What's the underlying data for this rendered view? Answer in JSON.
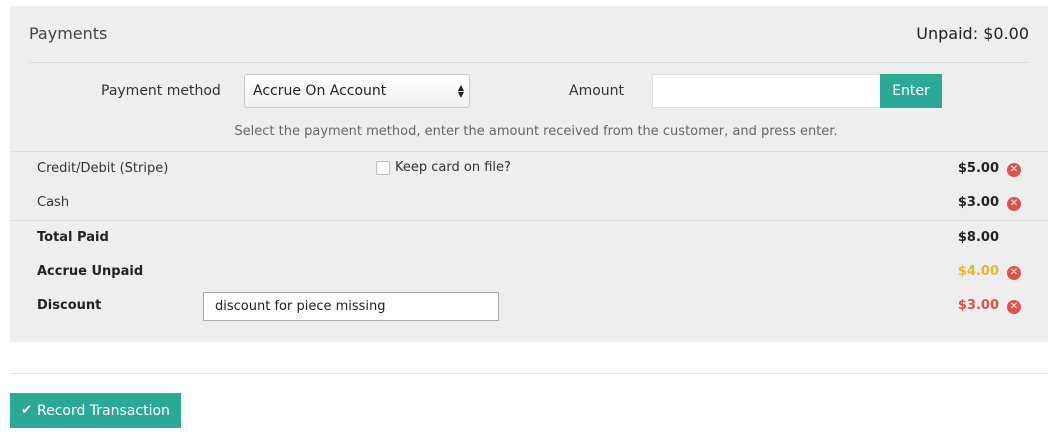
{
  "payments": {
    "title": "Payments",
    "unpaid": "Unpaid: $0.00"
  },
  "form": {
    "method_label": "Payment method",
    "method_value": "Accrue On Account",
    "amount_label": "Amount",
    "amount_value": "",
    "enter_label": "Enter",
    "help": "Select the payment method, enter the amount received from the customer, and press enter."
  },
  "rows": [
    {
      "label": "Credit/Debit (Stripe)",
      "amount": "$5.00",
      "checkbox_label": "Keep card on file?",
      "checked": false
    },
    {
      "label": "Cash",
      "amount": "$3.00"
    },
    {
      "label": "Total Paid",
      "amount": "$8.00"
    },
    {
      "label": "Accrue Unpaid",
      "amount": "$4.00"
    },
    {
      "label": "Discount",
      "amount": "$3.00",
      "note": "discount for piece missing"
    }
  ],
  "colors": {
    "accent": "#2aa996",
    "danger": "#e0514d",
    "warning": "#e8b730",
    "discount": "#e0514d",
    "panel_bg": "#eeeeee"
  },
  "icons": {
    "remove": "remove-circle-icon",
    "check": "check-icon",
    "select": "select-arrows-icon"
  },
  "actions": {
    "record_label": "Record Transaction"
  }
}
